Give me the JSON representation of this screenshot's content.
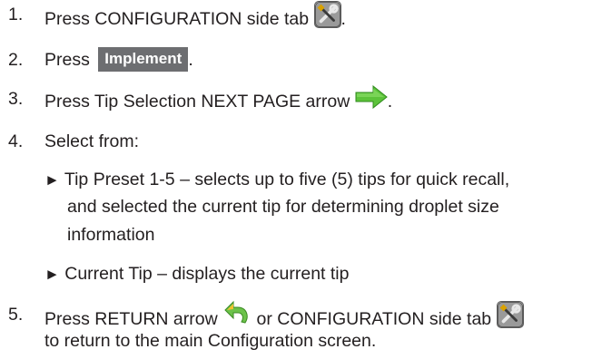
{
  "steps": [
    {
      "number": "1.",
      "text_before": "Press CONFIGURATION side tab",
      "text_after": ".",
      "icon": "wrench-screwdriver-icon"
    },
    {
      "number": "2.",
      "text_before": "Press",
      "button": "Implement",
      "text_after": "."
    },
    {
      "number": "3.",
      "text_before": "Press Tip Selection NEXT PAGE arrow",
      "text_after": ".",
      "icon": "green-right-arrow-icon"
    },
    {
      "number": "4.",
      "text": "Select from:"
    },
    {
      "number": "5.",
      "text_before": "Press RETURN arrow",
      "text_middle": "or CONFIGURATION side tab",
      "line2": "to return to the main Configuration screen.",
      "icons": [
        "return-arrow-icon",
        "wrench-screwdriver-icon"
      ]
    }
  ],
  "bullets": [
    {
      "marker": "►",
      "lines": [
        "Tip Preset 1-5 – selects up to five (5) tips for quick recall,",
        "and selected the current tip for determining droplet size",
        "information"
      ]
    },
    {
      "marker": "►",
      "lines": [
        "Current Tip – displays the current tip"
      ]
    }
  ]
}
